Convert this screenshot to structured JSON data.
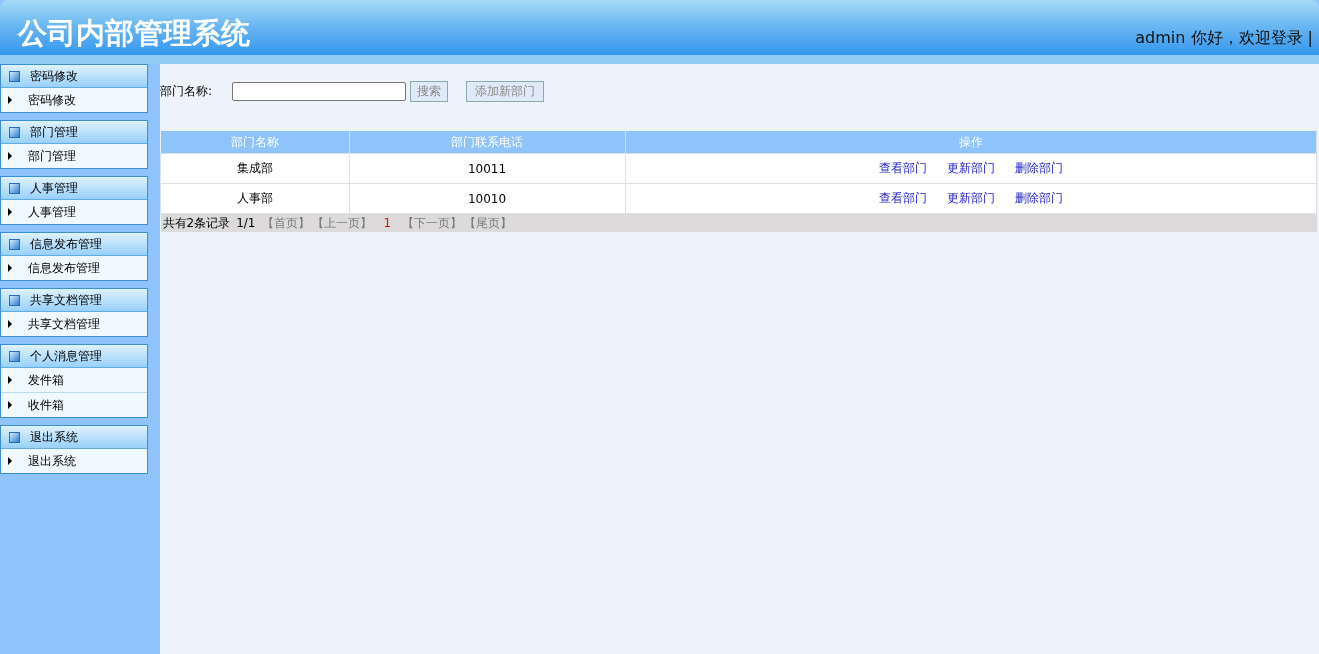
{
  "header": {
    "title": "公司内部管理系统",
    "user_greeting": "admin 你好，欢迎登录 |"
  },
  "sidebar": {
    "groups": [
      {
        "title": "密码修改",
        "items": [
          {
            "label": "密码修改"
          }
        ]
      },
      {
        "title": "部门管理",
        "items": [
          {
            "label": "部门管理"
          }
        ]
      },
      {
        "title": "人事管理",
        "items": [
          {
            "label": "人事管理"
          }
        ]
      },
      {
        "title": "信息发布管理",
        "items": [
          {
            "label": "信息发布管理"
          }
        ]
      },
      {
        "title": "共享文档管理",
        "items": [
          {
            "label": "共享文档管理"
          }
        ]
      },
      {
        "title": "个人消息管理",
        "items": [
          {
            "label": "发件箱"
          },
          {
            "label": "收件箱"
          }
        ]
      },
      {
        "title": "退出系统",
        "items": [
          {
            "label": "退出系统"
          }
        ]
      }
    ]
  },
  "search": {
    "label": "部门名称:",
    "search_button": "搜索",
    "add_button": "添加新部门"
  },
  "table": {
    "columns": [
      "部门名称",
      "部门联系电话",
      "操作"
    ],
    "rows": [
      {
        "name": "集成部",
        "phone": "10011",
        "actions": [
          "查看部门",
          "更新部门",
          "删除部门"
        ]
      },
      {
        "name": "人事部",
        "phone": "10010",
        "actions": [
          "查看部门",
          "更新部门",
          "删除部门"
        ]
      }
    ]
  },
  "pagination": [
    {
      "kind": "text",
      "label": "共有2条记录"
    },
    {
      "kind": "text",
      "label": "1/1"
    },
    {
      "kind": "link",
      "label": "【首页】",
      "disabled": true
    },
    {
      "kind": "link",
      "label": "【上一页】",
      "disabled": true
    },
    {
      "kind": "current",
      "label": "1"
    },
    {
      "kind": "link",
      "label": "【下一页】",
      "disabled": true
    },
    {
      "kind": "link",
      "label": "【尾页】",
      "disabled": true
    }
  ]
}
